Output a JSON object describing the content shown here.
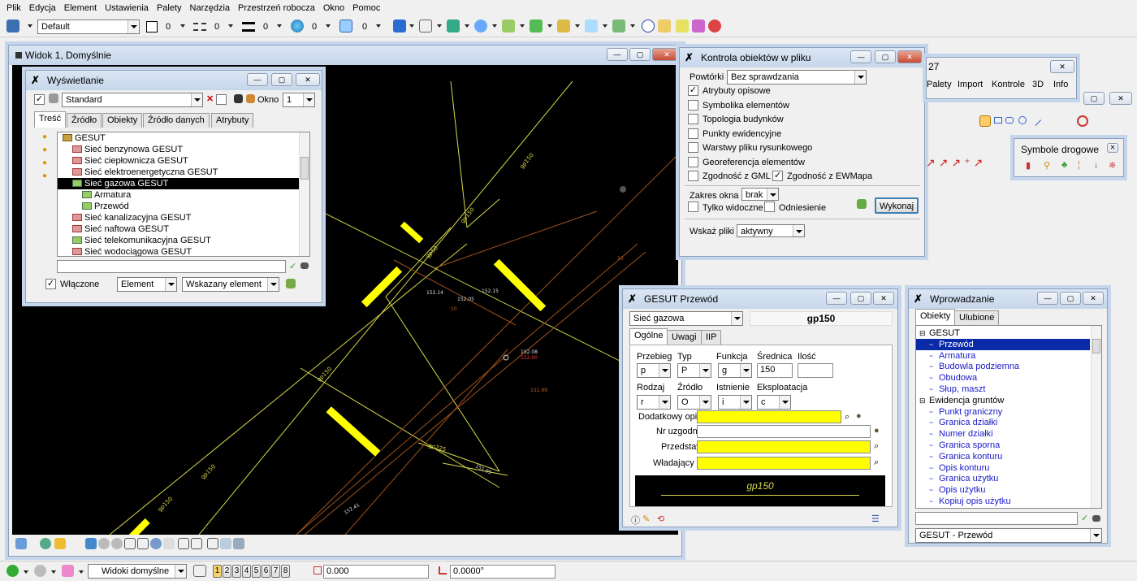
{
  "menu": [
    "Plik",
    "Edycja",
    "Element",
    "Ustawienia",
    "Palety",
    "Narzędzia",
    "Przestrzeń robocza",
    "Okno",
    "Pomoc"
  ],
  "toolbar": {
    "style_value": "Default",
    "color_val": "0",
    "linestyle_val": "0",
    "weight_val": "0",
    "transp_val": "0",
    "prio_val": "0"
  },
  "view": {
    "title": "Widok 1, Domyślnie"
  },
  "drawing_labels": [
    "gp150",
    "gp150",
    "gp150",
    "gp150",
    "gp150",
    "gp250",
    "gp50",
    "gp225",
    "152.14",
    "152.15",
    "152.08",
    "152.00",
    "151.95",
    "152.41",
    "152.05",
    "10",
    "10",
    "151.99"
  ],
  "display": {
    "title": "Wyświetlanie",
    "standard": "Standard",
    "okno_label": "Okno",
    "okno_val": "1",
    "tabs": [
      "Treść",
      "Źródło",
      "Obiekty",
      "Źródło danych",
      "Atrybuty"
    ],
    "tree": [
      {
        "label": "GESUT",
        "indent": 0,
        "icon": "folder"
      },
      {
        "label": "Sieć benzynowa GESUT",
        "indent": 1,
        "icon": "red"
      },
      {
        "label": "Sieć ciepłownicza GESUT",
        "indent": 1,
        "icon": "red"
      },
      {
        "label": "Sieć elektroenergetyczna GESUT",
        "indent": 1,
        "icon": "red"
      },
      {
        "label": "Sieć gazowa GESUT",
        "indent": 1,
        "icon": "green",
        "selected": true
      },
      {
        "label": "Armatura",
        "indent": 2,
        "icon": "green"
      },
      {
        "label": "Przewód",
        "indent": 2,
        "icon": "green"
      },
      {
        "label": "Sieć kanalizacyjna GESUT",
        "indent": 1,
        "icon": "red"
      },
      {
        "label": "Sieć naftowa GESUT",
        "indent": 1,
        "icon": "red"
      },
      {
        "label": "Sieć telekomunikacyjna GESUT",
        "indent": 1,
        "icon": "green"
      },
      {
        "label": "Sieć wodociągowa GESUT",
        "indent": 1,
        "icon": "red"
      }
    ],
    "wlaczone": "Włączone",
    "element_combo": "Element",
    "wskazany_combo": "Wskazany element"
  },
  "kontrola": {
    "title": "Kontrola obiektów w pliku",
    "powtorki_label": "Powtórki",
    "powtorki_val": "Bez sprawdzania",
    "checks": [
      {
        "label": "Atrybuty opisowe",
        "checked": true
      },
      {
        "label": "Symbolika elementów",
        "checked": false
      },
      {
        "label": "Topologia budynków",
        "checked": false
      },
      {
        "label": "Punkty ewidencyjne",
        "checked": false
      },
      {
        "label": "Warstwy pliku rysunkowego",
        "checked": false
      },
      {
        "label": "Georeferencja elementów",
        "checked": false
      }
    ],
    "gml": "Zgodność z GML",
    "ewmapa": "Zgodność z EWMapa",
    "zakres_label": "Zakres okna",
    "zakres_val": "brak",
    "tylko": "Tylko widoczne",
    "odniesienie": "Odniesienie",
    "wykonaj": "Wykonaj",
    "wskaz_label": "Wskaż pliki",
    "wskaz_val": "aktywny"
  },
  "palette": {
    "title_frag": "27",
    "menu": [
      "Palety",
      "Import",
      "Kontrole",
      "3D",
      "Info"
    ]
  },
  "symbole": {
    "title": "Symbole drogowe"
  },
  "gesut": {
    "title": "GESUT Przewód",
    "siec": "Sieć gazowa",
    "code": "gp150",
    "tabs": [
      "Ogólne",
      "Uwagi",
      "IIP"
    ],
    "col_labels": [
      "Przebieg",
      "Typ",
      "Funkcja",
      "Średnica",
      "Ilość"
    ],
    "col_vals": [
      "p",
      "P",
      "g",
      "150",
      ""
    ],
    "row2_labels": [
      "Rodzaj",
      "Źródło",
      "Istnienie",
      "Eksploatacja"
    ],
    "row2_vals": [
      "r",
      "O",
      "i",
      "c"
    ],
    "dodatkowy": "Dodatkowy opis",
    "nr_uzg": "Nr uzgodnienia",
    "przedst": "Przedstawiciel",
    "wladajacy": "Władający",
    "preview": "gp150"
  },
  "wprow": {
    "title": "Wprowadzanie",
    "tabs": [
      "Obiekty",
      "Ulubione"
    ],
    "items": [
      {
        "label": "GESUT",
        "indent": 0,
        "group": true
      },
      {
        "label": "Przewód",
        "indent": 1,
        "selected": true
      },
      {
        "label": "Armatura",
        "indent": 1
      },
      {
        "label": "Budowla podziemna",
        "indent": 1
      },
      {
        "label": "Obudowa",
        "indent": 1
      },
      {
        "label": "Słup, maszt",
        "indent": 1
      },
      {
        "label": "Ewidencja gruntów",
        "indent": 0,
        "group": true
      },
      {
        "label": "Punkt graniczny",
        "indent": 1
      },
      {
        "label": "Granica działki",
        "indent": 1
      },
      {
        "label": "Numer działki",
        "indent": 1
      },
      {
        "label": "Granica sporna",
        "indent": 1
      },
      {
        "label": "Granica konturu",
        "indent": 1
      },
      {
        "label": "Opis konturu",
        "indent": 1
      },
      {
        "label": "Granica użytku",
        "indent": 1
      },
      {
        "label": "Opis użytku",
        "indent": 1
      },
      {
        "label": "Kopiuj opis użytku",
        "indent": 1
      }
    ],
    "bottom_combo": "GESUT - Przewód"
  },
  "status": {
    "views_combo": "Widoki domyślne",
    "pages": [
      "1",
      "2",
      "3",
      "4",
      "5",
      "6",
      "7",
      "8"
    ],
    "coord": "0.000",
    "angle": "0.0000°"
  }
}
